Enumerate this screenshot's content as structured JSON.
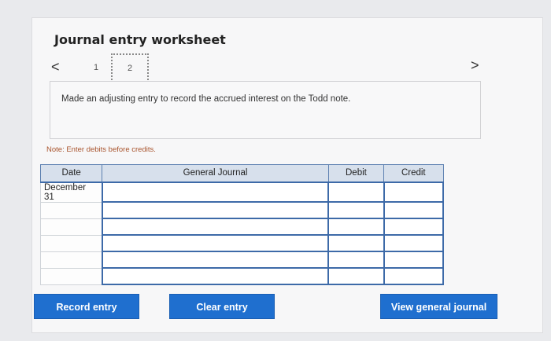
{
  "worksheet": {
    "title": "Journal entry worksheet",
    "nav": {
      "prev_glyph": "<",
      "next_glyph": ">",
      "steps": [
        "1",
        "2"
      ],
      "current_step": 2
    },
    "prompt": "Made an adjusting entry to record the accrued interest on the Todd note.",
    "note": "Note: Enter debits before credits."
  },
  "journal": {
    "headers": {
      "date": "Date",
      "account": "General Journal",
      "debit": "Debit",
      "credit": "Credit"
    },
    "rows": [
      {
        "date": "December 31",
        "account": "",
        "debit": "",
        "credit": ""
      },
      {
        "date": "",
        "account": "",
        "debit": "",
        "credit": ""
      },
      {
        "date": "",
        "account": "",
        "debit": "",
        "credit": ""
      },
      {
        "date": "",
        "account": "",
        "debit": "",
        "credit": ""
      },
      {
        "date": "",
        "account": "",
        "debit": "",
        "credit": ""
      },
      {
        "date": "",
        "account": "",
        "debit": "",
        "credit": ""
      }
    ]
  },
  "buttons": {
    "record": "Record entry",
    "clear": "Clear entry",
    "view": "View general journal"
  },
  "colors": {
    "button": "#1f6fcf",
    "header": "#d7e0ec",
    "input_border": "#3d6aa8",
    "note": "#a8532c"
  },
  "icons": {
    "prev": "chevron-left-icon",
    "next": "chevron-right-icon"
  }
}
